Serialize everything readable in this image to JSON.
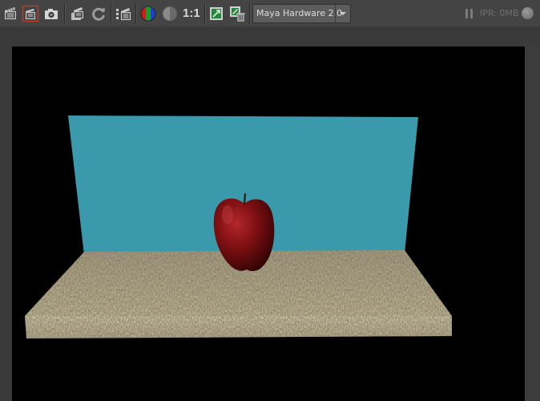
{
  "toolbar": {
    "buttons": [
      {
        "name": "redo-previous-render",
        "icon": "clapper-icon"
      },
      {
        "name": "render-region",
        "icon": "clapper-region-icon",
        "state": "active"
      },
      {
        "name": "snapshot",
        "icon": "camera-icon"
      },
      {
        "name": "render-sequence",
        "icon": "clapper-stack-icon"
      },
      {
        "name": "refresh-render",
        "icon": "refresh-icon"
      },
      {
        "name": "ipr-render",
        "icon": "clapper-ipr-icon"
      },
      {
        "name": "rgb-channels",
        "icon": "rgb-sphere-icon"
      },
      {
        "name": "alpha-channel",
        "icon": "alpha-sphere-icon"
      },
      {
        "name": "real-size",
        "label": "1:1"
      },
      {
        "name": "keep-image",
        "icon": "keep-image-icon"
      },
      {
        "name": "remove-image",
        "icon": "remove-image-icon"
      }
    ],
    "ratio_label": "1:1",
    "renderer": {
      "selected": "Maya Hardware 2.0"
    },
    "ipr": {
      "label": "IPR: 0MB"
    }
  },
  "colors": {
    "panel": "#444444",
    "canvas": "#000000",
    "wall": "#3a9aab",
    "apple": "#7a0d0f",
    "table": "#b9ad8a",
    "active_outline": "#c0392b"
  }
}
